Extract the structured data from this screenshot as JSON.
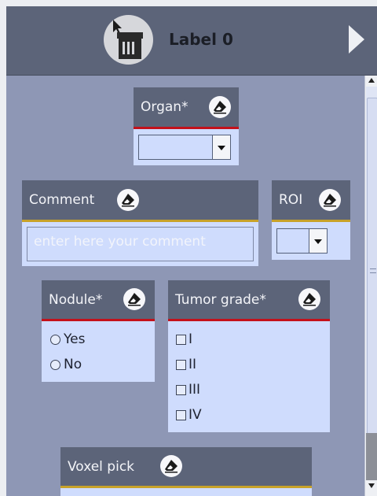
{
  "header": {
    "title": "Label 0"
  },
  "widgets": {
    "organ": {
      "title": "Organ*"
    },
    "comment": {
      "title": "Comment",
      "placeholder": "enter here your comment"
    },
    "roi": {
      "title": "ROI"
    },
    "nodule": {
      "title": "Nodule*",
      "options": [
        "Yes",
        "No"
      ]
    },
    "tumor_grade": {
      "title": "Tumor grade*",
      "options": [
        "I",
        "II",
        "III",
        "IV"
      ]
    },
    "voxel_pick": {
      "title": "Voxel pick"
    }
  },
  "colors": {
    "header_bg": "#5c6479",
    "panel_bg": "#8e97b5",
    "widget_body": "#cfdcfd",
    "required_bar": "#c4111b",
    "optional_bar": "#c8a229"
  },
  "icons": [
    "trash-cursor-icon",
    "eraser-icon",
    "next-arrow-icon"
  ]
}
